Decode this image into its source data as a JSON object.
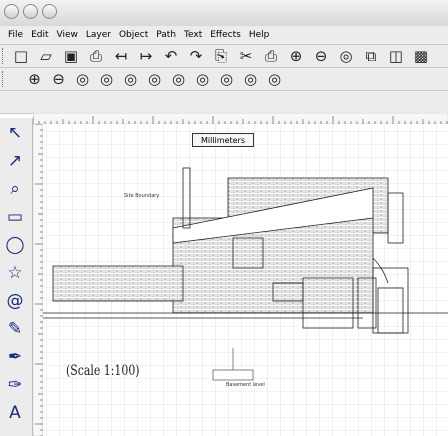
{
  "window": {
    "title": ""
  },
  "menu": [
    "File",
    "Edit",
    "View",
    "Layer",
    "Object",
    "Path",
    "Text",
    "Effects",
    "Help"
  ],
  "toolbar1": [
    {
      "name": "new-icon",
      "glyph": "□"
    },
    {
      "name": "open-icon",
      "glyph": "▱"
    },
    {
      "name": "save-icon",
      "glyph": "▣"
    },
    {
      "name": "print-icon",
      "glyph": "⎙"
    },
    {
      "name": "import-icon",
      "glyph": "↤"
    },
    {
      "name": "export-icon",
      "glyph": "↦"
    },
    {
      "name": "undo-icon",
      "glyph": "↶"
    },
    {
      "name": "redo-icon",
      "glyph": "↷"
    },
    {
      "name": "copy-icon",
      "glyph": "⎘"
    },
    {
      "name": "cut-icon",
      "glyph": "✂"
    },
    {
      "name": "paste-icon",
      "glyph": "⎙"
    },
    {
      "name": "zoom-in-icon",
      "glyph": "⊕"
    },
    {
      "name": "zoom-out-icon",
      "glyph": "⊖"
    },
    {
      "name": "zoom-fit-icon",
      "glyph": "◎"
    },
    {
      "name": "duplicate-icon",
      "glyph": "⧉"
    },
    {
      "name": "clone-icon",
      "glyph": "◫"
    },
    {
      "name": "group-icon",
      "glyph": "▩"
    }
  ],
  "toolbar2": [
    {
      "name": "zoom-1-icon",
      "glyph": "⊕"
    },
    {
      "name": "zoom-2-icon",
      "glyph": "⊖"
    },
    {
      "name": "zoom-3-icon",
      "glyph": "◎"
    },
    {
      "name": "zoom-4-icon",
      "glyph": "◎"
    },
    {
      "name": "zoom-5-icon",
      "glyph": "◎"
    },
    {
      "name": "zoom-6-icon",
      "glyph": "◎"
    },
    {
      "name": "zoom-7-icon",
      "glyph": "◎"
    },
    {
      "name": "zoom-8-icon",
      "glyph": "◎"
    },
    {
      "name": "zoom-9-icon",
      "glyph": "◎"
    },
    {
      "name": "zoom-10-icon",
      "glyph": "◎"
    },
    {
      "name": "zoom-11-icon",
      "glyph": "◎"
    }
  ],
  "tools": [
    {
      "name": "selector-tool-icon",
      "glyph": "↖"
    },
    {
      "name": "node-tool-icon",
      "glyph": "↗"
    },
    {
      "name": "zoom-tool-icon",
      "glyph": "⌕"
    },
    {
      "name": "rectangle-tool-icon",
      "glyph": "▭"
    },
    {
      "name": "ellipse-tool-icon",
      "glyph": "◯"
    },
    {
      "name": "star-tool-icon",
      "glyph": "☆"
    },
    {
      "name": "spiral-tool-icon",
      "glyph": "@"
    },
    {
      "name": "pencil-tool-icon",
      "glyph": "✎"
    },
    {
      "name": "pen-tool-icon",
      "glyph": "✒"
    },
    {
      "name": "calligraphy-tool-icon",
      "glyph": "✑"
    },
    {
      "name": "text-tool-icon",
      "glyph": "A"
    }
  ],
  "context": {
    "units": "Millimeters"
  },
  "drawing": {
    "scale_label": "(Scale 1:100)",
    "site_label": "Site Boundary",
    "level_label": "Basement level"
  },
  "colors": {
    "chrome": "#ececec",
    "tool_blue": "#1b2a7a",
    "line": "#222222",
    "grid": "#c8d0e8"
  }
}
